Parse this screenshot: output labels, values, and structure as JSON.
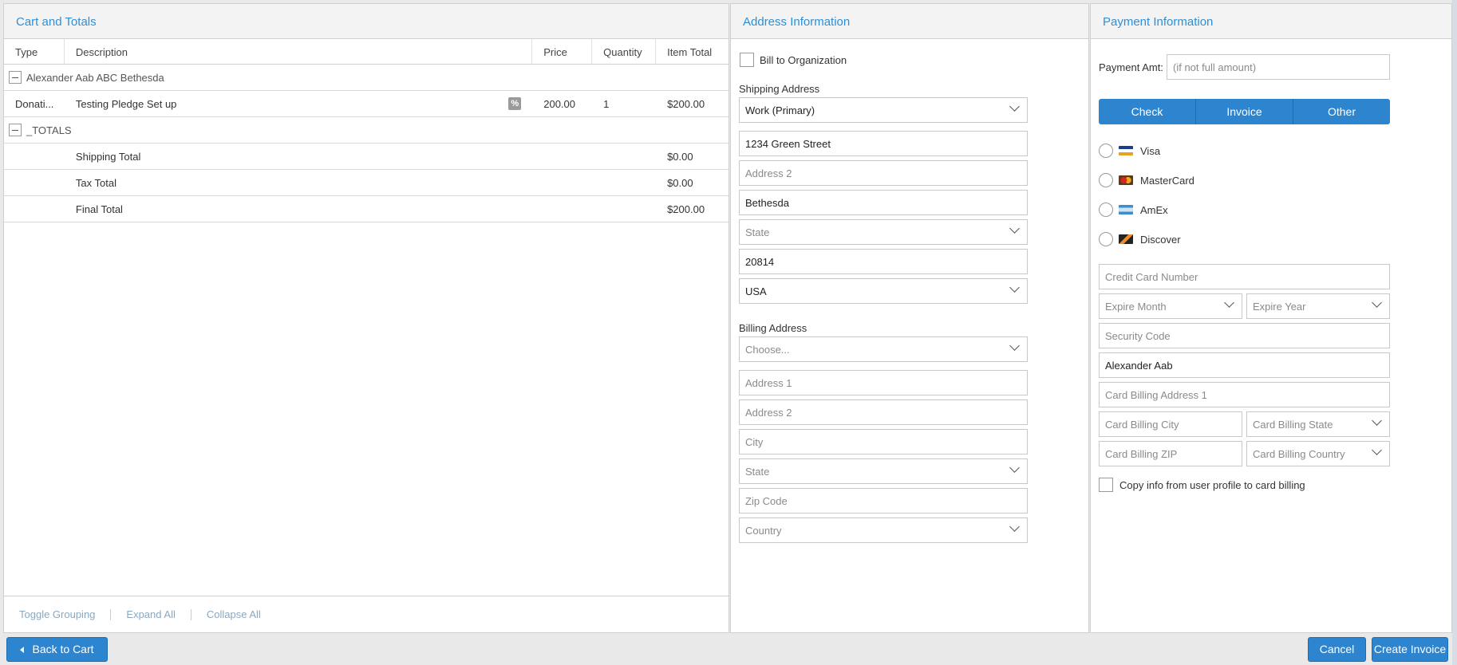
{
  "cart": {
    "title": "Cart and Totals",
    "columns": [
      "Type",
      "Description",
      "Price",
      "Quantity",
      "Item Total"
    ],
    "group1": "Alexander Aab ABC Bethesda",
    "item": {
      "type": "Donati...",
      "description": "Testing Pledge Set up",
      "price": "200.00",
      "quantity": "1",
      "total": "$200.00",
      "discount_icon": "%"
    },
    "group2": "_TOTALS",
    "totals": [
      {
        "label": "Shipping Total",
        "value": "$0.00"
      },
      {
        "label": "Tax Total",
        "value": "$0.00"
      },
      {
        "label": "Final Total",
        "value": "$200.00"
      }
    ],
    "footer": {
      "toggle": "Toggle Grouping",
      "expand": "Expand All",
      "collapse": "Collapse All"
    }
  },
  "address": {
    "title": "Address Information",
    "bill_to_org": "Bill to Organization",
    "shipping_label": "Shipping Address",
    "shipping": {
      "type": "Work (Primary)",
      "address1": "1234 Green Street",
      "address2_ph": "Address 2",
      "city": "Bethesda",
      "state_ph": "State",
      "zip": "20814",
      "country": "USA"
    },
    "billing_label": "Billing Address",
    "billing": {
      "choose_ph": "Choose...",
      "address1_ph": "Address 1",
      "address2_ph": "Address 2",
      "city_ph": "City",
      "state_ph": "State",
      "zip_ph": "Zip Code",
      "country_ph": "Country"
    }
  },
  "payment": {
    "title": "Payment Information",
    "amt_label": "Payment Amt:",
    "amt_ph": "(if not full amount)",
    "methods": [
      "Check",
      "Invoice",
      "Other"
    ],
    "cards": [
      "Visa",
      "MasterCard",
      "AmEx",
      "Discover"
    ],
    "cc_number_ph": "Credit Card Number",
    "expire_month_ph": "Expire Month",
    "expire_year_ph": "Expire Year",
    "security_ph": "Security Code",
    "name": "Alexander Aab",
    "billing_address_ph": "Card Billing Address 1",
    "billing_city_ph": "Card Billing City",
    "billing_state_ph": "Card Billing State",
    "billing_zip_ph": "Card Billing ZIP",
    "billing_country_ph": "Card Billing Country",
    "copy_info": "Copy info from user profile to card billing"
  },
  "actions": {
    "back": "Back to Cart",
    "cancel": "Cancel",
    "create": "Create Invoice"
  },
  "colors": {
    "accent": "#2e85cf",
    "header_text": "#2e8fd6"
  }
}
